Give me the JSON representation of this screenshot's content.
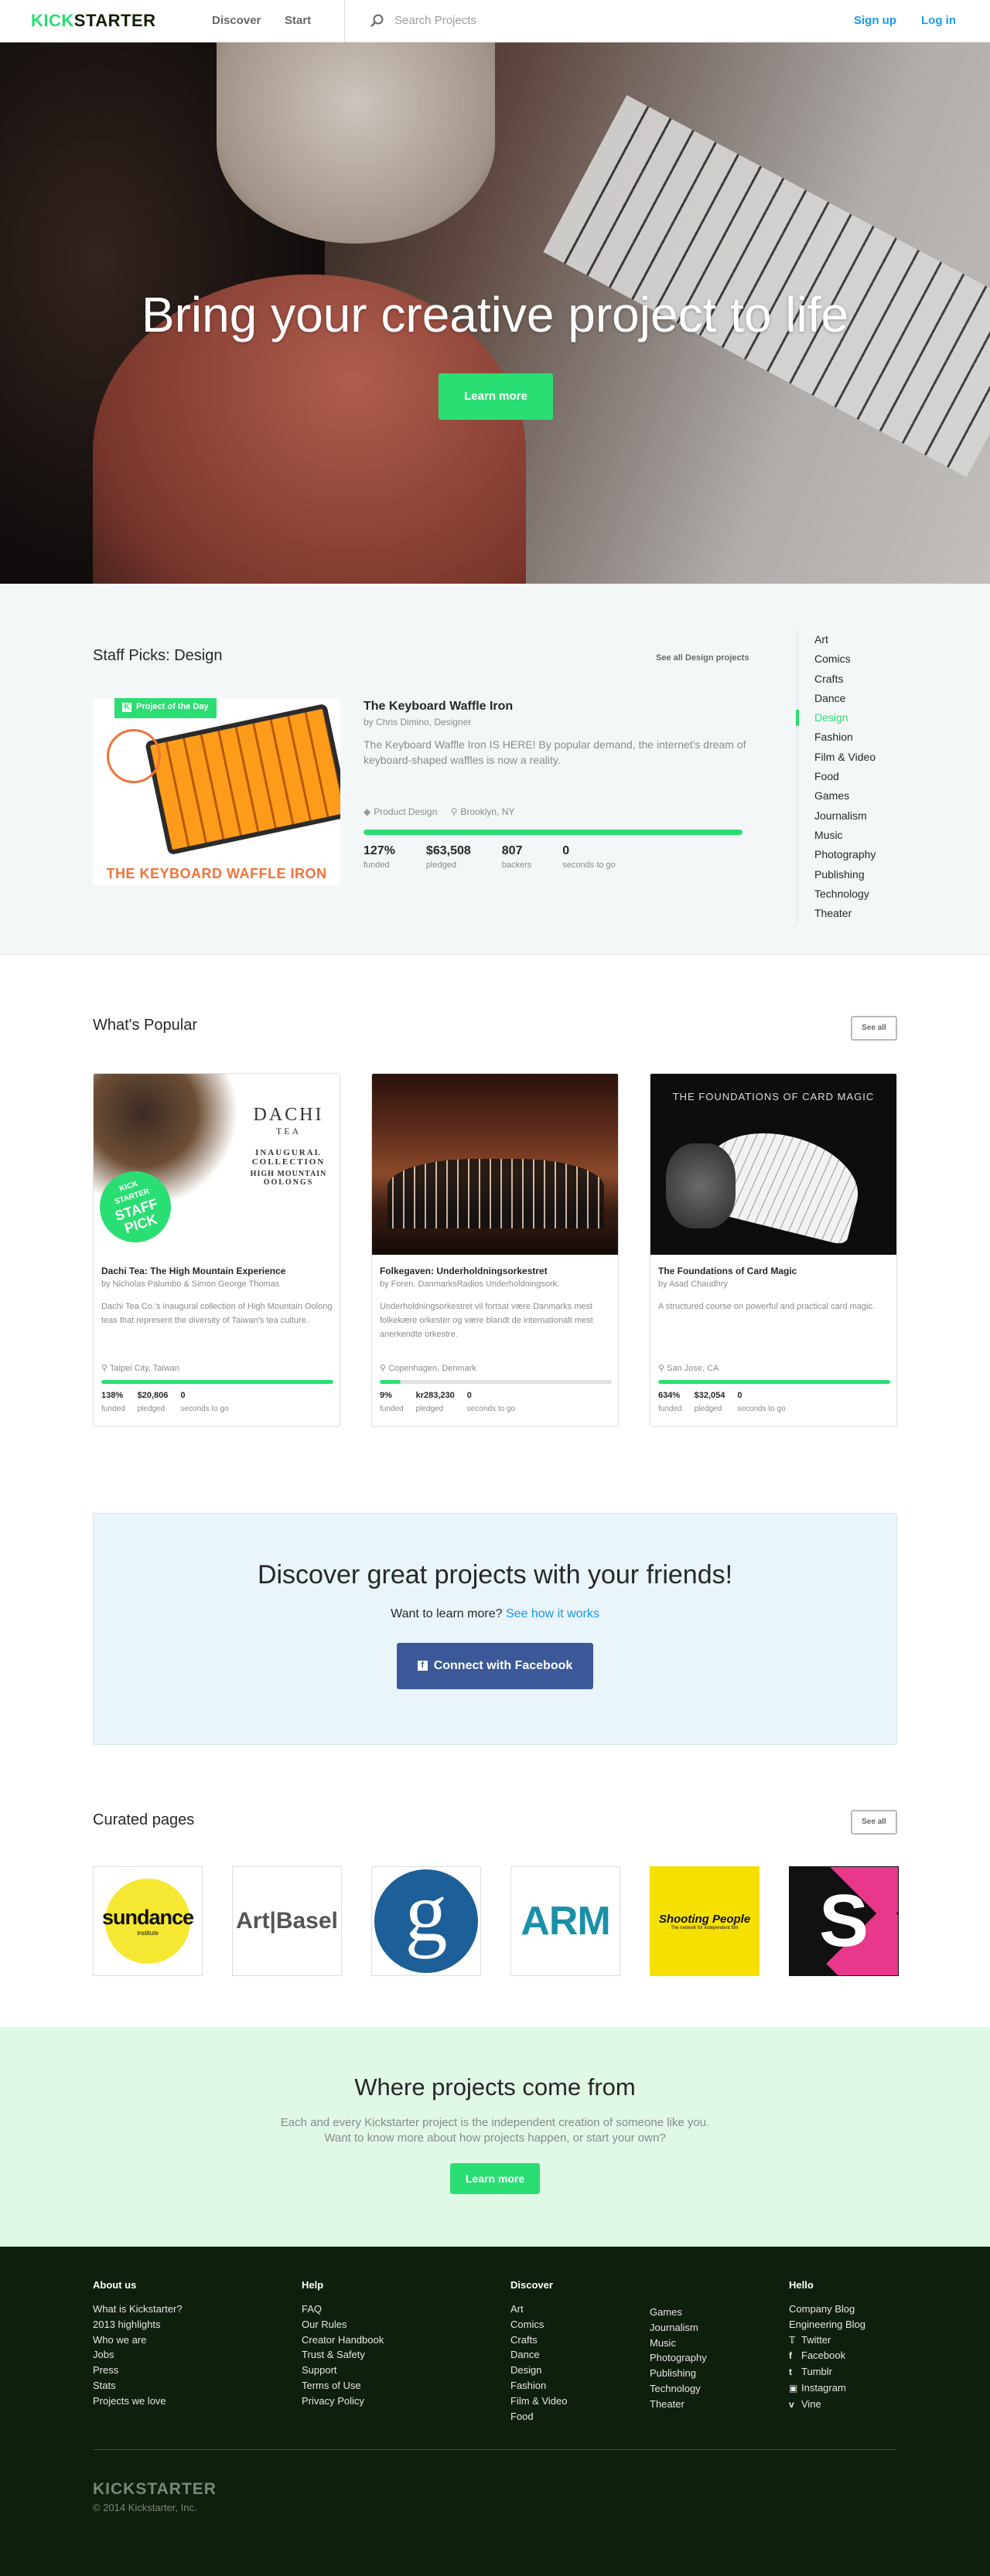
{
  "header": {
    "logo_a": "KICK",
    "logo_b": "STARTER",
    "nav": [
      "Discover",
      "Start"
    ],
    "search_placeholder": "Search Projects",
    "signup": "Sign up",
    "login": "Log in"
  },
  "hero": {
    "headline": "Bring your creative project to life",
    "cta": "Learn more"
  },
  "staff_picks": {
    "title": "Staff Picks:  Design",
    "see_all": "See all Design projects",
    "badge": "Project of the Day",
    "image_caption": "THE KEYBOARD WAFFLE IRON",
    "project": {
      "title": "The Keyboard Waffle Iron",
      "by": "by Chris Dimino, Designer",
      "blurb": "The Keyboard Waffle Iron IS HERE! By popular demand, the internet's dream of keyboard-shaped waffles is now a reality.",
      "category": "Product Design",
      "location": "Brooklyn, NY",
      "progress": 1.0,
      "stats": [
        {
          "num": "127%",
          "lbl": "funded"
        },
        {
          "num": "$63,508",
          "lbl": "pledged"
        },
        {
          "num": "807",
          "lbl": "backers"
        },
        {
          "num": "0",
          "lbl": "seconds to go"
        }
      ]
    },
    "categories": [
      "Art",
      "Comics",
      "Crafts",
      "Dance",
      "Design",
      "Fashion",
      "Film & Video",
      "Food",
      "Games",
      "Journalism",
      "Music",
      "Photography",
      "Publishing",
      "Technology",
      "Theater"
    ],
    "active_category": "Design"
  },
  "popular": {
    "title": "What's Popular",
    "see_all": "See all",
    "cards": [
      {
        "title": "Dachi Tea: The High Mountain Experience",
        "by": "by Nicholas Palumbo & Simon George Thomas",
        "blurb": "Dachi Tea Co.'s inaugural collection of High Mountain Oolong teas that represent the diversity of Taiwan's tea culture.",
        "location": "Taipei City, Taiwan",
        "progress": 1.0,
        "stats": [
          {
            "num": "138%",
            "lbl": "funded"
          },
          {
            "num": "$20,806",
            "lbl": "pledged"
          },
          {
            "num": "0",
            "lbl": "seconds to go"
          }
        ],
        "thumb_text": [
          "DACHI",
          "TEA",
          "INAUGURAL",
          "COLLECTION",
          "HIGH MOUNTAIN",
          "OOLONGS"
        ],
        "sticker": [
          "KICK",
          "STARTER",
          "STAFF",
          "PICK"
        ]
      },
      {
        "title": "Folkegaven: Underholdningsorkestret",
        "by": "by Foren. DanmarksRadios Underholdningsork.",
        "blurb": "Underholdningsorkestret vil fortsat være Danmarks mest folkekære orkester og være blandt de internationalt mest anerkendte orkestre.",
        "location": "Copenhagen, Denmark",
        "progress": 0.09,
        "stats": [
          {
            "num": "9%",
            "lbl": "funded"
          },
          {
            "num": "kr283,230",
            "lbl": "pledged"
          },
          {
            "num": "0",
            "lbl": "seconds to go"
          }
        ]
      },
      {
        "title": "The Foundations of Card Magic",
        "by": "by Asad Chaudhry",
        "blurb": "A structured course on powerful and practical card magic.",
        "location": "San Jose, CA",
        "progress": 1.0,
        "stats": [
          {
            "num": "634%",
            "lbl": "funded"
          },
          {
            "num": "$32,054",
            "lbl": "pledged"
          },
          {
            "num": "0",
            "lbl": "seconds to go"
          }
        ],
        "thumb_text": "THE FOUNDATIONS OF CARD MAGIC"
      }
    ]
  },
  "friends": {
    "title": "Discover great projects with your friends!",
    "question": "Want to learn more?",
    "link": "See how it works",
    "button": "Connect with Facebook"
  },
  "curated": {
    "title": "Curated pages",
    "see_all": "See all",
    "tiles": [
      {
        "name": "sundance",
        "sub": "institute"
      },
      {
        "name": "Art|Basel"
      },
      {
        "name": "g"
      },
      {
        "name": "ARM"
      },
      {
        "name": "Shooting People",
        "sub": "The network for independent film"
      },
      {
        "name": "S"
      }
    ]
  },
  "where": {
    "title": "Where projects come from",
    "line1": "Each and every Kickstarter project is the independent creation of someone like you.",
    "line2": "Want to know more about how projects happen, or start your own?",
    "cta": "Learn more"
  },
  "footer": {
    "about": {
      "title": "About us",
      "items": [
        "What is Kickstarter?",
        "2013 highlights",
        "Who we are",
        "Jobs",
        "Press",
        "Stats",
        "Projects we love"
      ]
    },
    "help": {
      "title": "Help",
      "items": [
        "FAQ",
        "Our Rules",
        "Creator Handbook",
        "Trust & Safety",
        "Support",
        "Terms of Use",
        "Privacy Policy"
      ]
    },
    "discover": {
      "title": "Discover",
      "col1": [
        "Art",
        "Comics",
        "Crafts",
        "Dance",
        "Design",
        "Fashion",
        "Film & Video",
        "Food"
      ],
      "col2": [
        "Games",
        "Journalism",
        "Music",
        "Photography",
        "Publishing",
        "Technology",
        "Theater"
      ]
    },
    "hello": {
      "title": "Hello",
      "items": [
        "Company Blog",
        "Engineering Blog",
        "Twitter",
        "Facebook",
        "Tumblr",
        "Instagram",
        "Vine"
      ],
      "icons": [
        "",
        "",
        "twitter-icon",
        "facebook-icon",
        "tumblr-icon",
        "instagram-icon",
        "vine-icon"
      ]
    },
    "logo": "KICKSTARTER",
    "copyright": "© 2014 Kickstarter, Inc."
  }
}
